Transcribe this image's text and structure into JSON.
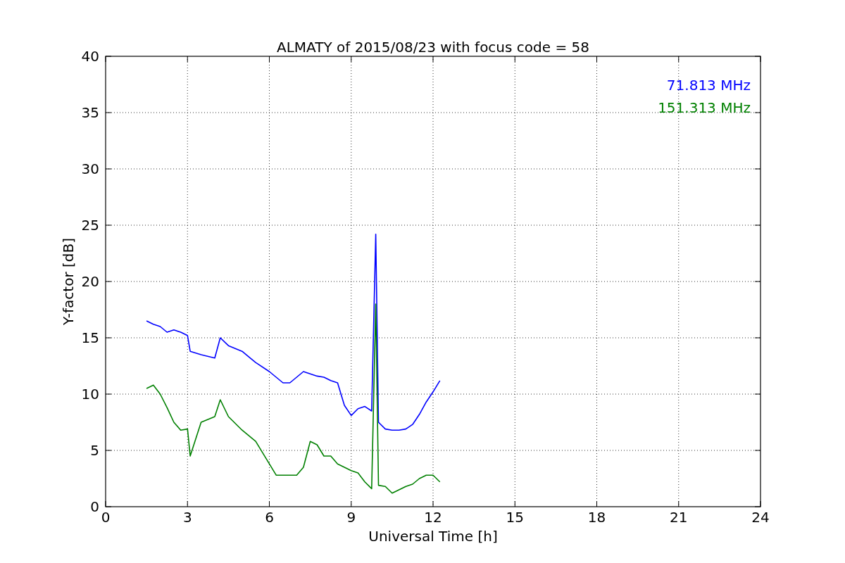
{
  "chart": {
    "chart_data": {
      "type": "line",
      "title": "ALMATY of 2015/08/23 with focus code = 58",
      "xlabel": "Universal Time [h]",
      "ylabel": "Y-factor [dB]",
      "x": [
        1.5,
        1.75,
        2,
        2.25,
        2.5,
        2.75,
        3,
        3.1,
        3.5,
        4,
        4.2,
        4.5,
        5,
        5.5,
        6,
        6.25,
        6.5,
        6.75,
        7,
        7.25,
        7.5,
        7.75,
        8,
        8.25,
        8.5,
        8.75,
        9,
        9.25,
        9.5,
        9.75,
        9.9,
        10,
        10.25,
        10.5,
        10.75,
        11,
        11.25,
        11.5,
        11.75,
        12,
        12.25
      ],
      "series": [
        {
          "name": "71.813 MHz",
          "color": "#0000ff",
          "values": [
            16.5,
            16.2,
            16.0,
            15.5,
            15.7,
            15.5,
            15.2,
            13.8,
            13.5,
            13.2,
            15.0,
            14.3,
            13.8,
            12.8,
            12.0,
            11.5,
            11.0,
            11.0,
            11.5,
            12.0,
            11.8,
            11.6,
            11.5,
            11.2,
            11.0,
            9.0,
            8.1,
            8.7,
            8.9,
            8.5,
            24.2,
            7.5,
            6.9,
            6.8,
            6.8,
            6.9,
            7.3,
            8.2,
            9.3,
            10.2,
            11.2
          ]
        },
        {
          "name": "151.313 MHz",
          "color": "#008000",
          "values": [
            10.5,
            10.8,
            10.0,
            8.8,
            7.5,
            6.8,
            6.9,
            4.5,
            7.5,
            8.0,
            9.5,
            8.0,
            6.8,
            5.8,
            3.8,
            2.8,
            2.8,
            2.8,
            2.8,
            3.5,
            5.8,
            5.5,
            4.5,
            4.5,
            3.8,
            3.5,
            3.2,
            3.0,
            2.2,
            1.6,
            18,
            1.9,
            1.8,
            1.2,
            1.5,
            1.8,
            2.0,
            2.5,
            2.8,
            2.8,
            2.2
          ]
        }
      ],
      "xlim": [
        0,
        24
      ],
      "ylim": [
        0,
        40
      ],
      "xticks": [
        0,
        3,
        6,
        9,
        12,
        15,
        18,
        21,
        24
      ],
      "yticks": [
        0,
        5,
        10,
        15,
        20,
        25,
        30,
        35,
        40
      ],
      "grid": true
    }
  }
}
